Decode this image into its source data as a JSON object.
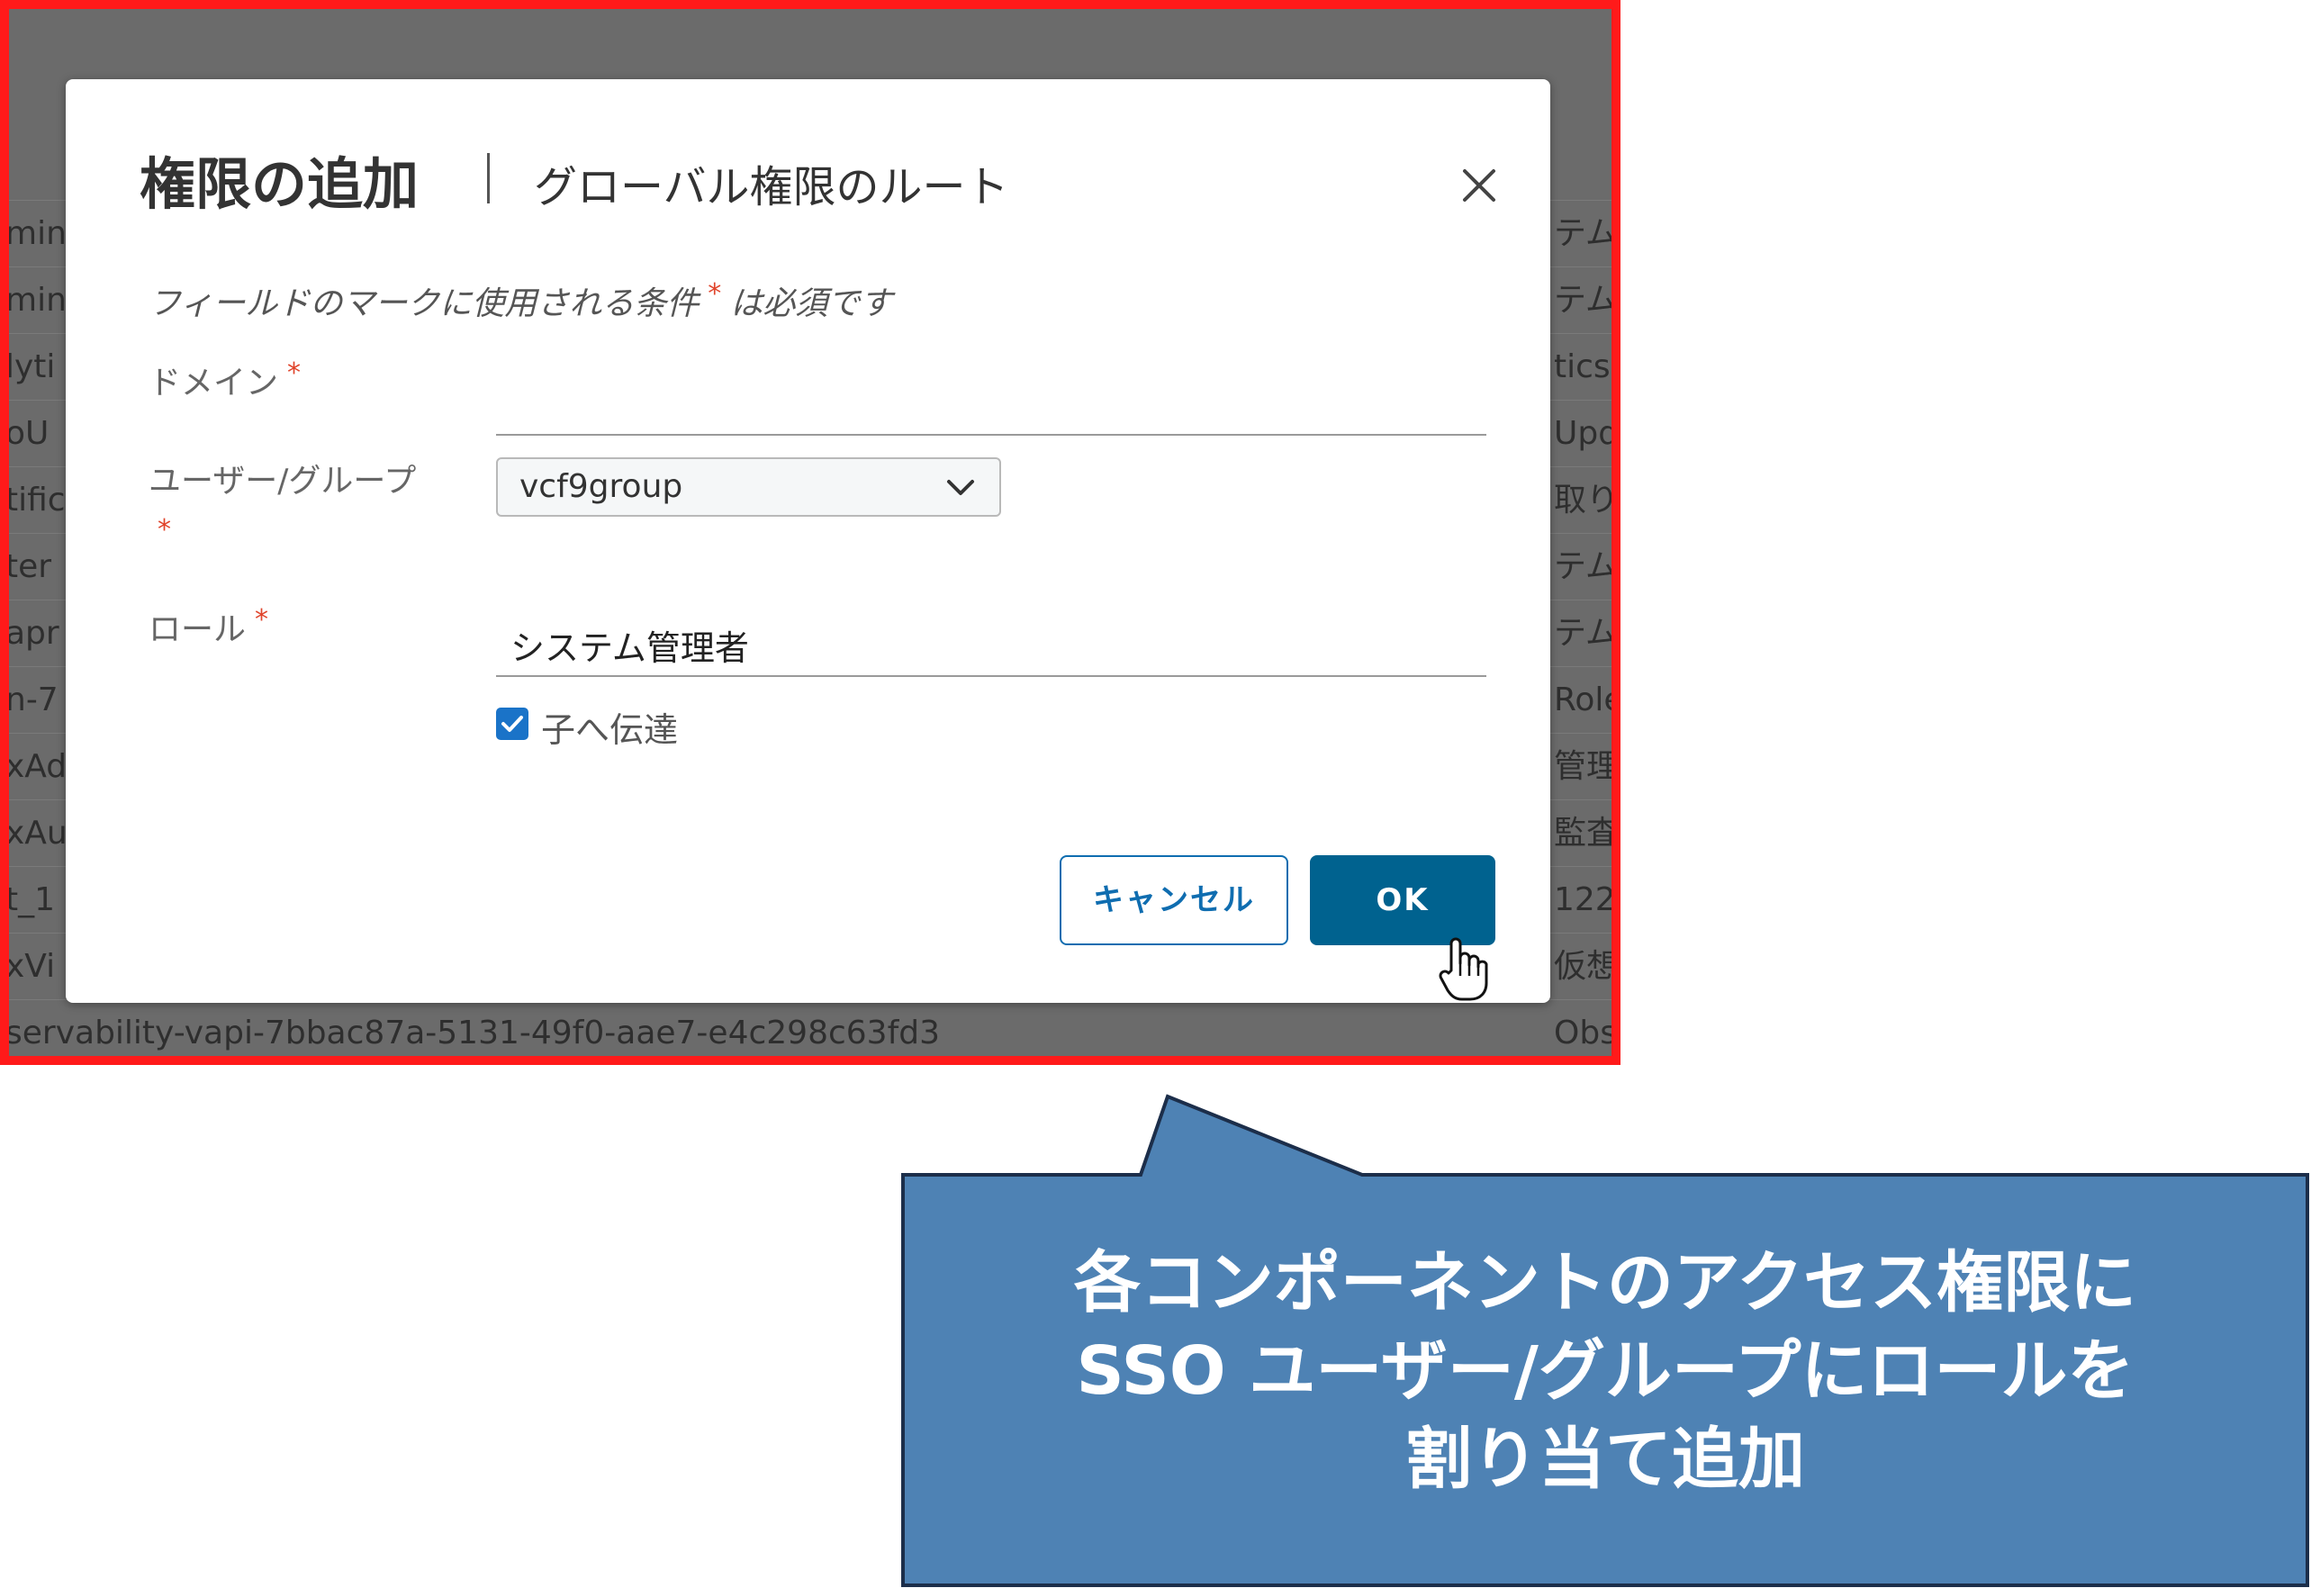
{
  "background_table": {
    "rows": [
      {
        "left": "min",
        "right": "テム管"
      },
      {
        "left": "min",
        "right": "テム管"
      },
      {
        "left": "lyti",
        "right": "tics"
      },
      {
        "left": "oU",
        "right": "Upd"
      },
      {
        "left": "tific",
        "right": "取り"
      },
      {
        "left": "ter",
        "right": "テム管"
      },
      {
        "left": "apr",
        "right": "テム管"
      },
      {
        "left": "n-7",
        "right": "Role"
      },
      {
        "left": "xAd",
        "right": "管理"
      },
      {
        "left": "xAu",
        "right": "監査"
      },
      {
        "left": "t_1",
        "right": "122"
      },
      {
        "left": "xVi",
        "right": "仮想"
      },
      {
        "left": "servability-vapi-7bbac87a-5131-49f0-aae7-e4c298c63fd3",
        "right": "Observal"
      }
    ]
  },
  "dialog": {
    "title": "権限の追加",
    "subtitle": "グローバル権限のルート",
    "required_note_prefix": "フィールドのマークに使用される条件",
    "required_mark": "*",
    "required_note_suffix": "は必須です",
    "domain": {
      "label": "ドメイン",
      "value": ""
    },
    "user_group": {
      "label": "ユーザー/グループ",
      "value": "vcf9group"
    },
    "role": {
      "label": "ロール",
      "value": "システム管理者"
    },
    "propagate": {
      "label": "子へ伝達",
      "checked": true
    },
    "cancel_label": "キャンセル",
    "ok_label": "OK"
  },
  "callout": {
    "lines": [
      "各コンポーネントのアクセス権限に",
      "SSO ユーザー/グループにロールを",
      "割り当て追加"
    ]
  },
  "colors": {
    "frame_border": "#ff1a1a",
    "primary_button": "#00628f",
    "callout_fill": "#4e82b4",
    "callout_border": "#1c2e4a",
    "required_mark": "#e0442b"
  }
}
